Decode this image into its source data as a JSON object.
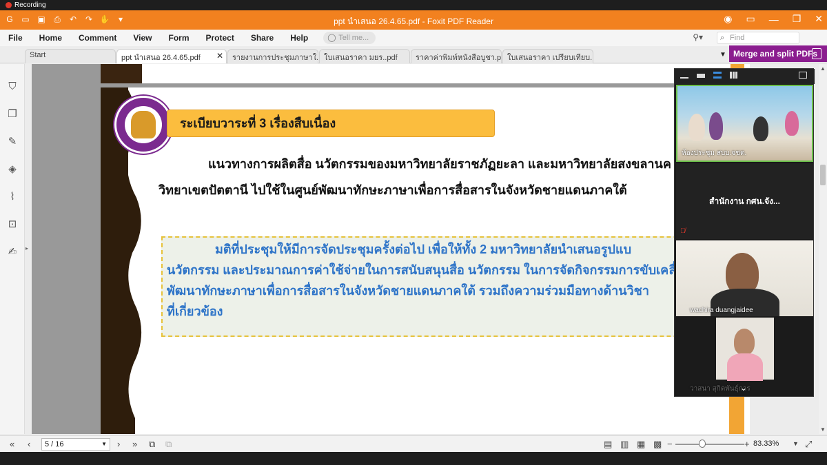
{
  "recording_label": "Recording",
  "window": {
    "title": "ppt นำเสนอ 26.4.65.pdf - Foxit PDF Reader"
  },
  "menu": [
    "File",
    "Home",
    "Comment",
    "View",
    "Form",
    "Protect",
    "Share",
    "Help"
  ],
  "tell_me_placeholder": "Tell me...",
  "find_placeholder": "Find",
  "tabs": [
    {
      "label": "Start",
      "active": false
    },
    {
      "label": "ppt นำเสนอ 26.4.65.pdf",
      "active": true
    },
    {
      "label": "รายงานการประชุมภาษาใ...",
      "active": false
    },
    {
      "label": "ใบเสนอราคา มยร..pdf",
      "active": false
    },
    {
      "label": "ราคาค่าพิมพ์หนังสือบูชา.pdf",
      "active": false
    },
    {
      "label": "ใบเสนอราคา เปรียบเทียบ...",
      "active": false
    }
  ],
  "merge_button": "Merge and split PDFs",
  "document": {
    "heading": "ระเบียบวาระที่ 3 เรื่องสืบเนื่อง",
    "para1_line1": "แนวทางการผลิตสื่อ นวัตกรรมของมหาวิทยาลัยราชภัฏยะลา และมหาวิทยาลัยสงขลานค",
    "para1_line2": "วิทยาเขตปัตตานี ไปใช้ในศูนย์พัฒนาทักษะภาษาเพื่อการสื่อสารในจังหวัดชายแดนภาคใต้",
    "para2_line1": "มติที่ประชุมให้มีการจัดประชุมครั้งต่อไป เพื่อให้ทั้ง 2 มหาวิทยาลัยนำเสนอรูปแบ",
    "para2_line2": "นวัตกรรม และประมาณการค่าใช้จ่ายในการสนับสนุนสื่อ นวัตกรรม ในการจัดกิจกรรมการขับเคลื่อน",
    "para2_line3": "พัฒนาทักษะภาษาเพื่อการสื่อสารในจังหวัดชายแดนภาคใต้ รวมถึงความร่วมมือทางด้านวิชา",
    "para2_line4": "ที่เกี่ยวข้อง"
  },
  "meeting": {
    "participants": [
      {
        "name": "ห้องประชุม สบบ.จชต.",
        "video": true
      },
      {
        "name": "สำนักงาน กศน.จัง...",
        "video": false
      },
      {
        "name": "wachira duangjaidee",
        "video": true
      },
      {
        "name": "วาสนา สุกิตพันธุ์การ",
        "video": true
      }
    ]
  },
  "status": {
    "page_value": "5 / 16",
    "zoom_value": "83.33%"
  },
  "colors": {
    "titlebar": "#f2811f",
    "merge": "#8b1d8f",
    "heading_box": "#fbbd3e",
    "decision_text": "#2e74c8"
  }
}
